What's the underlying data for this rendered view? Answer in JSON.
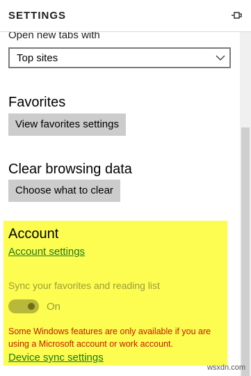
{
  "header": {
    "title": "SETTINGS",
    "pin_icon": "pin-icon"
  },
  "new_tabs": {
    "label": "Open new tabs with",
    "selected": "Top sites"
  },
  "favorites": {
    "title": "Favorites",
    "button_label": "View favorites settings"
  },
  "clear_data": {
    "title": "Clear browsing data",
    "button_label": "Choose what to clear"
  },
  "account": {
    "title": "Account",
    "settings_link": "Account settings",
    "sync_label": "Sync your favorites and reading list",
    "toggle_state": "On",
    "warning": "Some Windows features are only available if you are using a Microsoft account or work account.",
    "device_sync_link": "Device sync settings",
    "highlight_color": "#fcfc51"
  },
  "watermark": "wsxdn.com"
}
